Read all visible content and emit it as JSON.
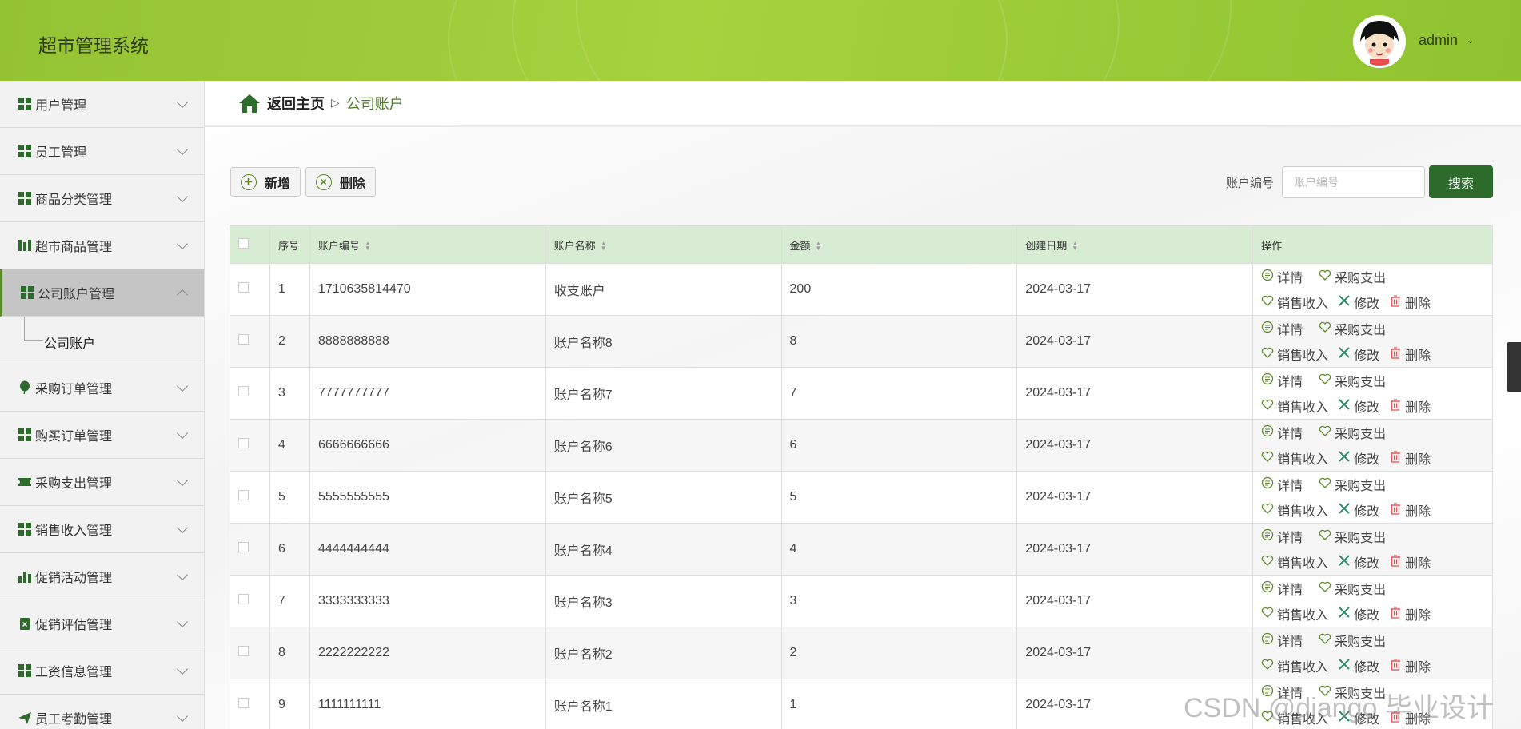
{
  "header": {
    "title": "超市管理系统",
    "user": "admin"
  },
  "sidebar": {
    "items": [
      {
        "label": "用户管理",
        "icon": "grid-icon"
      },
      {
        "label": "员工管理",
        "icon": "grid-icon"
      },
      {
        "label": "商品分类管理",
        "icon": "grid-icon"
      },
      {
        "label": "超市商品管理",
        "icon": "bars-icon"
      },
      {
        "label": "公司账户管理",
        "icon": "grid-icon",
        "active": true,
        "sub": [
          "公司账户"
        ]
      },
      {
        "label": "采购订单管理",
        "icon": "balloon-icon"
      },
      {
        "label": "购买订单管理",
        "icon": "grid-icon"
      },
      {
        "label": "采购支出管理",
        "icon": "ticket-icon"
      },
      {
        "label": "销售收入管理",
        "icon": "grid-icon"
      },
      {
        "label": "促销活动管理",
        "icon": "chart-icon"
      },
      {
        "label": "促销评估管理",
        "icon": "clipboard-icon"
      },
      {
        "label": "工资信息管理",
        "icon": "grid-icon"
      },
      {
        "label": "员工考勤管理",
        "icon": "send-icon"
      }
    ]
  },
  "breadcrumb": {
    "home": "返回主页",
    "separator": "▷",
    "current": "公司账户"
  },
  "toolbar": {
    "add": "新增",
    "delete": "删除"
  },
  "search": {
    "label": "账户编号",
    "placeholder": "账户编号",
    "button": "搜索"
  },
  "table": {
    "headers": [
      "序号",
      "账户编号",
      "账户名称",
      "金额",
      "创建日期",
      "操作"
    ],
    "actions": {
      "detail": "详情",
      "purchase": "采购支出",
      "sales": "销售收入",
      "edit": "修改",
      "delete": "删除"
    },
    "rows": [
      {
        "no": "1",
        "code": "1710635814470",
        "name": "收支账户",
        "amount": "200",
        "date": "2024-03-17"
      },
      {
        "no": "2",
        "code": "8888888888",
        "name": "账户名称8",
        "amount": "8",
        "date": "2024-03-17"
      },
      {
        "no": "3",
        "code": "7777777777",
        "name": "账户名称7",
        "amount": "7",
        "date": "2024-03-17"
      },
      {
        "no": "4",
        "code": "6666666666",
        "name": "账户名称6",
        "amount": "6",
        "date": "2024-03-17"
      },
      {
        "no": "5",
        "code": "5555555555",
        "name": "账户名称5",
        "amount": "5",
        "date": "2024-03-17"
      },
      {
        "no": "6",
        "code": "4444444444",
        "name": "账户名称4",
        "amount": "4",
        "date": "2024-03-17"
      },
      {
        "no": "7",
        "code": "3333333333",
        "name": "账户名称3",
        "amount": "3",
        "date": "2024-03-17"
      },
      {
        "no": "8",
        "code": "2222222222",
        "name": "账户名称2",
        "amount": "2",
        "date": "2024-03-17"
      },
      {
        "no": "9",
        "code": "1111111111",
        "name": "账户名称1",
        "amount": "1",
        "date": "2024-03-17"
      }
    ]
  },
  "watermark": "CSDN @django 毕业设计",
  "colors": {
    "header": "#9acb3a",
    "accent": "#2d6b2d",
    "table_header": "#d8ecd3"
  }
}
